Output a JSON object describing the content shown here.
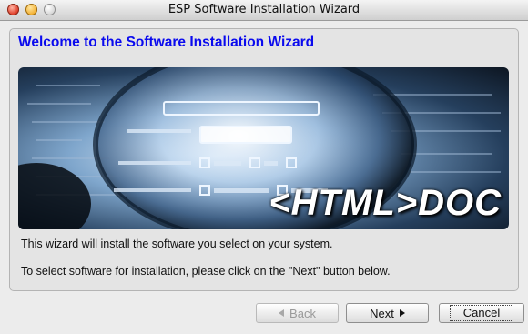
{
  "window": {
    "title": "ESP Software Installation Wizard"
  },
  "content": {
    "heading": "Welcome to the Software Installation Wizard",
    "banner_text": "<HTML>DOC",
    "info_line1": "This wizard will install the software you select on your system.",
    "info_line2": "To select software for installation, please click on the \"Next\" button below."
  },
  "buttons": {
    "back_label": "Back",
    "next_label": "Next",
    "cancel_label": "Cancel"
  },
  "colors": {
    "heading": "#0a0aee",
    "panel": "#e4e4e4"
  }
}
